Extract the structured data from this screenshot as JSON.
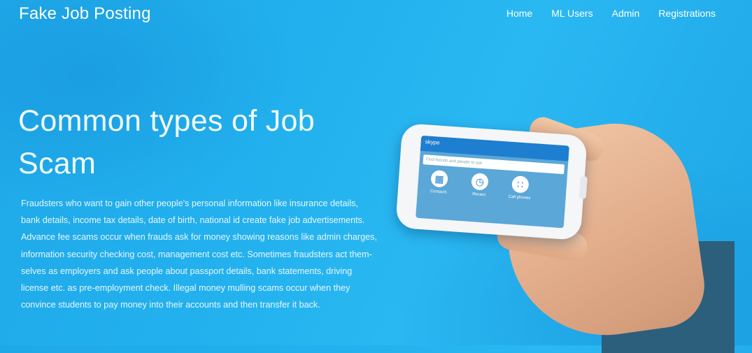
{
  "brand": "Fake Job Posting",
  "nav": {
    "home": "Home",
    "ml_users": "ML Users",
    "admin": "Admin",
    "registrations": "Registrations"
  },
  "hero": {
    "title": "Common types of Job Scam",
    "body": "Fraudsters who want to gain other people's personal information like insurance details, bank details, income tax details, date of birth, national id create fake job advertisements. Advance fee scams occur when frauds ask for money showing reasons like admin charges, information security checking cost, management cost etc. Sometimes fraudsters act them- selves as employers and ask people about passport details, bank statements, driving license etc. as pre-employment check. Illegal money mulling scams occur when they convince students to pay money into their accounts and then transfer it back."
  },
  "phone_app": {
    "logo": "skype",
    "search_placeholder": "Find friends and people to ask",
    "tiles": [
      {
        "label": "Contacts",
        "icon": "contacts-icon"
      },
      {
        "label": "Recent",
        "icon": "clock-icon"
      },
      {
        "label": "Call phones",
        "icon": "dialpad-icon"
      }
    ]
  },
  "colors": {
    "background": "#22b0ee",
    "text": "#ffffff",
    "app_blue": "#1e7ecf"
  }
}
